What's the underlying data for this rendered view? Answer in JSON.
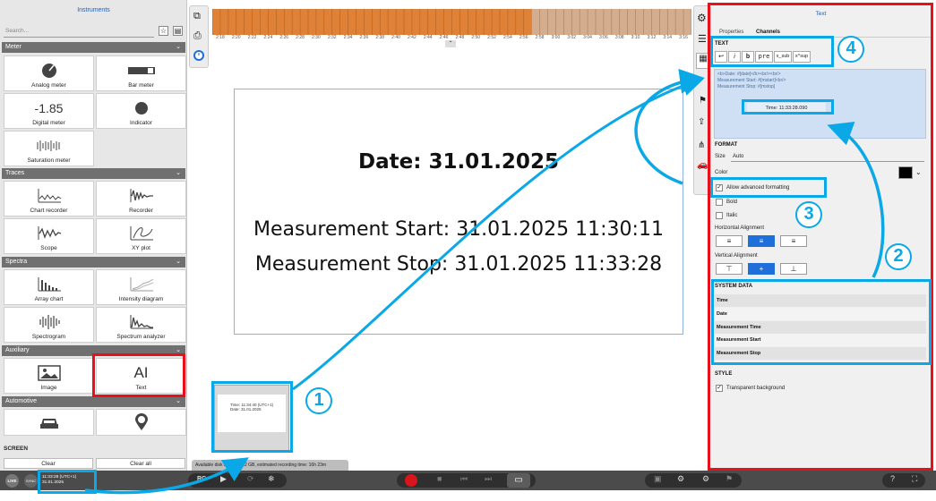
{
  "left_panel": {
    "title": "Instruments",
    "search_placeholder": "Search...",
    "sections": [
      {
        "name": "Meter",
        "items": [
          "Analog meter",
          "Bar meter",
          "Digital meter",
          "Indicator",
          "Saturation meter"
        ]
      },
      {
        "name": "Traces",
        "items": [
          "Chart recorder",
          "Recorder",
          "Scope",
          "XY plot"
        ]
      },
      {
        "name": "Spectra",
        "items": [
          "Array chart",
          "Intensity diagram",
          "Spectrogram",
          "Spectrum analyzer"
        ]
      },
      {
        "name": "Auxiliary",
        "items": [
          "Image",
          "Text"
        ]
      },
      {
        "name": "Automotive",
        "items": []
      }
    ],
    "digital_meter_value": "-1.85",
    "screen_label": "SCREEN",
    "clear_label": "Clear",
    "clear_all_label": "Clear all"
  },
  "timeline": {
    "labels": [
      "2:18",
      "2:20",
      "2:22",
      "2:24",
      "2:26",
      "2:28",
      "2:30",
      "2:32",
      "2:34",
      "2:36",
      "2:38",
      "2:40",
      "2:42",
      "2:44",
      "2:46",
      "2:48",
      "2:50",
      "2:52",
      "2:54",
      "2:56",
      "2:58",
      "3:00",
      "3:02",
      "3:04",
      "3:06",
      "3:08",
      "3:10",
      "3:12",
      "3:14",
      "3:16"
    ],
    "recorded_fraction": 0.665
  },
  "text_instrument": {
    "date_line": "Date: 31.01.2025",
    "start_line": "Measurement Start: 31.01.2025 11:30:11",
    "stop_line": "Measurement Stop: 31.01.2025 11:33:28"
  },
  "thumbnail": {
    "line1": "Time: 11:34:40 (UTC+1)",
    "line2": "Date: 31.01.2025"
  },
  "status_bar": {
    "text": "Available disk space: 40.2 GB, estimated recording time: 16h 23m"
  },
  "bottom_bar": {
    "live_label": "LIVE",
    "sync_label": "SYNC",
    "clock_time": "11:33:28 (UTC+1)",
    "clock_date": "31.01.2025",
    "rc_label": "RC"
  },
  "right_panel": {
    "title": "Text",
    "tabs": [
      "Properties",
      "Channels"
    ],
    "text_header": "TEXT",
    "format_buttons": [
      "↩",
      "i",
      "b",
      "pre",
      "x_sub",
      "x^sup"
    ],
    "text_content": [
      "<b>Date: #[date]</b><br/><br/>",
      "Measurement Start: #[mstart]<br/>",
      "Measurement Stop: #[mstop]"
    ],
    "time_preview": "Time: 11:33:28.090",
    "format_header": "FORMAT",
    "size_label": "Size",
    "size_value": "Auto",
    "color_label": "Color",
    "color_value": "#000000",
    "allow_advanced_label": "Allow advanced formatting",
    "allow_advanced_checked": true,
    "bold_label": "Bold",
    "italic_label": "Italic",
    "halign_label": "Horizontal Alignment",
    "valign_label": "Vertical Alignment",
    "system_data_header": "SYSTEM DATA",
    "system_data_items": [
      "Time",
      "Date",
      "Measurement Time",
      "Measurement Start",
      "Measurement Stop"
    ],
    "style_header": "STYLE",
    "transparent_bg_label": "Transparent background",
    "transparent_bg_checked": true
  },
  "annotations": [
    "1",
    "2",
    "3",
    "4"
  ],
  "colors": {
    "annotation_cyan": "#0aa8e6",
    "annotation_red": "#e8101a",
    "timeline_recorded": "#df8238",
    "timeline_future": "#d3ad8e",
    "accent_blue": "#1e6fd9",
    "record_red": "#d9141c"
  }
}
